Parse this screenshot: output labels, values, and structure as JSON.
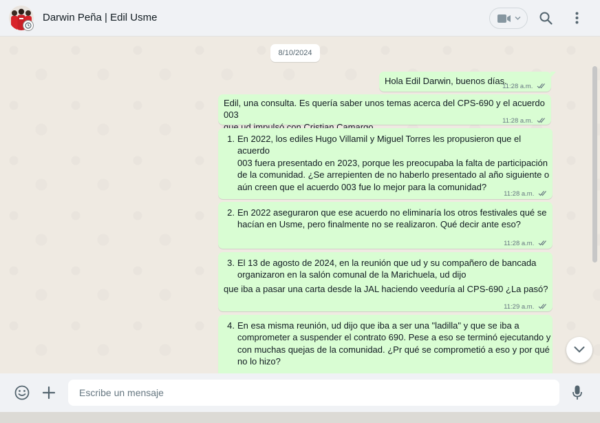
{
  "header": {
    "contact_name": "Darwin Peña | Edil Usme",
    "icons": [
      "avatar",
      "status-icon",
      "video-call-icon",
      "chevron-down-icon",
      "search-icon",
      "menu-dots-icon"
    ]
  },
  "chat": {
    "date_label": "8/10/2024",
    "messages": [
      {
        "text": "Hola Edil Darwin, buenos días.",
        "time": "11:28 a.m."
      },
      {
        "lines": [
          "Edil, una consulta. Es quería saber unos temas acerca del CPS-690 y el acuerdo 003",
          "que ud impulsó con Cristian Camargo."
        ],
        "time": "11:28 a.m."
      },
      {
        "num": "1.",
        "lines": [
          "En 2022, los ediles Hugo Villamil y Miguel Torres les propusieron que el acuerdo",
          "003 fuera presentado en 2023, porque les preocupaba la falta de participación",
          "de la comunidad. ¿Se arrepienten de no haberlo presentado al año siguiente o",
          "aún creen que el acuerdo 003 fue lo mejor para la comunidad?"
        ],
        "time": "11:28 a.m."
      },
      {
        "num": "2.",
        "lines": [
          "En 2022 aseguraron que ese acuerdo no eliminaría los otros festivales qué se",
          "hacían en Usme, pero finalmente no se realizaron. Qué decir ante eso?"
        ],
        "time": "11:28 a.m."
      },
      {
        "num": "3.",
        "lines": [
          "El 13 de agosto de 2024, en la reunión que ud y su compañero de bancada",
          "organizaron en la salón comunal de la Marichuela, ud dijo"
        ],
        "extra": "que iba a pasar una carta desde la JAL haciendo veeduría al CPS-690 ¿La pasó?",
        "time": "11:29 a.m."
      },
      {
        "num": "4.",
        "lines": [
          "En esa misma reunión, ud dijo que iba a ser una \"ladilla\" y que se iba a",
          "comprometer a suspender el contrato 690. Pese a eso se terminó ejecutando y",
          "con muchas quejas de la comunidad. ¿Pr qué se comprometió a eso y por qué",
          "no lo hizo?"
        ]
      }
    ]
  },
  "composer": {
    "placeholder": "Escribe un mensaje",
    "icons": [
      "emoji-icon",
      "plus-icon",
      "microphone-icon"
    ]
  },
  "colors": {
    "outgoing_bubble": "#d9fdd3",
    "chat_background": "#efeae2",
    "header_background": "#f0f2f5",
    "read_tick": "#667781"
  }
}
